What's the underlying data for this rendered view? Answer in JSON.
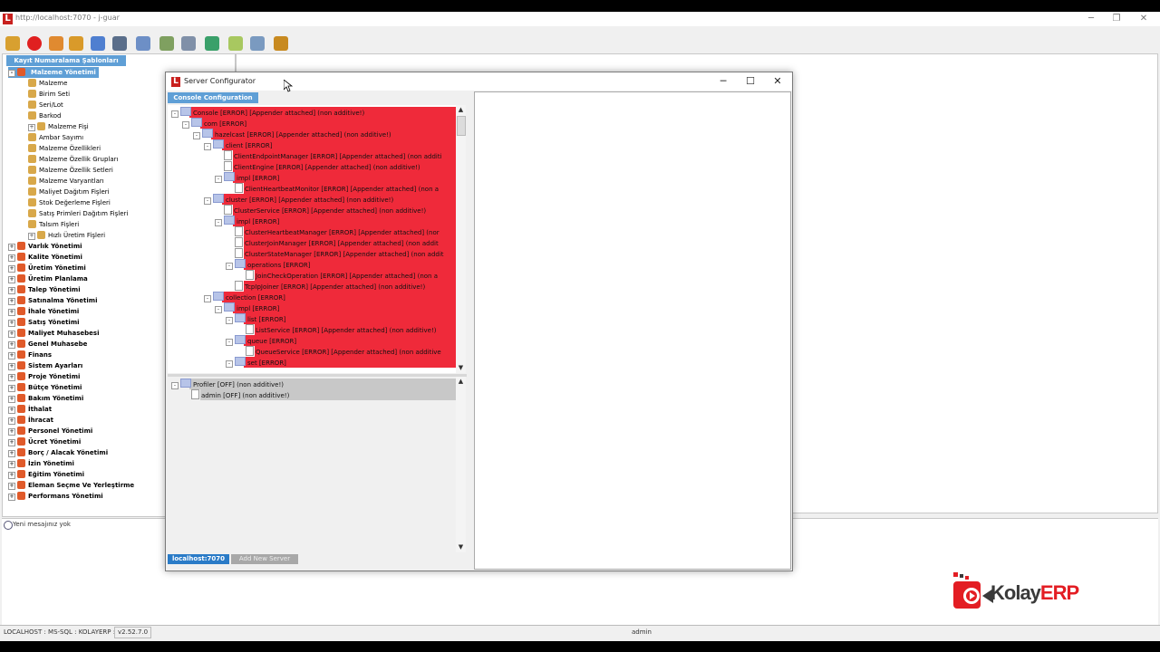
{
  "app": {
    "title": "http://localhost:7070 - j-guar",
    "logo_letter": "L"
  },
  "toolbar": {
    "icons": [
      "key-icon",
      "power-icon",
      "users-icon",
      "user-icon",
      "chart-icon",
      "window-icon",
      "network-icon",
      "tree-icon",
      "card-icon",
      "books-icon",
      "folder-icon",
      "table-icon",
      "wrench-icon"
    ]
  },
  "left": {
    "tab_label": "Kayıt Numaralama Şablonları",
    "root": "Malzeme Yönetimi",
    "children": [
      "Malzeme",
      "Birim Seti",
      "Seri/Lot",
      "Barkod",
      "Malzeme Fişi",
      "Ambar Sayımı",
      "Malzeme Özellikleri",
      "Malzeme Özellik Grupları",
      "Malzeme Özellik Setleri",
      "Malzeme Varyantları",
      "Maliyet Dağıtım Fişleri",
      "Stok Değerleme Fişleri",
      "Satış Primleri Dağıtım Fişleri",
      "Talsım Fişleri",
      "Hızlı Üretim Fişleri"
    ],
    "modules": [
      "Varlık Yönetimi",
      "Kalite Yönetimi",
      "Üretim Yönetimi",
      "Üretim Planlama",
      "Talep Yönetimi",
      "Satınalma Yönetimi",
      "İhale Yönetimi",
      "Satış Yönetimi",
      "Maliyet Muhasebesi",
      "Genel Muhasebe",
      "Finans",
      "Sistem Ayarları",
      "Proje Yönetimi",
      "Bütçe Yönetimi",
      "Bakım Yönetimi",
      "İthalat",
      "İhracat",
      "Personel Yönetimi",
      "Ücret Yönetimi",
      "Borç / Alacak Yönetimi",
      "İzin Yönetimi",
      "Eğitim Yönetimi",
      "Eleman Seçme Ve Yerleştirme",
      "Performans Yönetimi"
    ]
  },
  "messages": {
    "text": "Yeni mesajınız yok"
  },
  "status": {
    "connection": "LOCALHOST : MS-SQL : KOLAYERP :",
    "version": "v2.52.7.0",
    "user": "admin"
  },
  "brand": {
    "name_kolay": "Kolay",
    "name_erp": "ERP",
    "color_red": "#e31d23",
    "color_dark": "#3a3a3a"
  },
  "dialog": {
    "title": "Server Configurator",
    "tab_label": "Console Configuration",
    "loggers": [
      {
        "depth": 0,
        "kind": "folder",
        "pm": "-",
        "text": "Console [ERROR] [Appender attached] (non additive!)"
      },
      {
        "depth": 1,
        "kind": "folder",
        "pm": "-",
        "text": "com [ERROR]"
      },
      {
        "depth": 2,
        "kind": "folder",
        "pm": "-",
        "text": "hazelcast [ERROR] [Appender attached] (non additive!)"
      },
      {
        "depth": 3,
        "kind": "folder",
        "pm": "-",
        "text": "client [ERROR]"
      },
      {
        "depth": 4,
        "kind": "doc",
        "pm": "",
        "text": "ClientEndpointManager [ERROR] [Appender attached] (non additi"
      },
      {
        "depth": 4,
        "kind": "doc",
        "pm": "",
        "text": "ClientEngine [ERROR] [Appender attached] (non additive!)"
      },
      {
        "depth": 4,
        "kind": "folder",
        "pm": "-",
        "text": "impl [ERROR]"
      },
      {
        "depth": 5,
        "kind": "doc",
        "pm": "",
        "text": "ClientHeartbeatMonitor [ERROR] [Appender attached] (non a"
      },
      {
        "depth": 3,
        "kind": "folder",
        "pm": "-",
        "text": "cluster [ERROR] [Appender attached] (non additive!)"
      },
      {
        "depth": 4,
        "kind": "doc",
        "pm": "",
        "text": "ClusterService [ERROR] [Appender attached] (non additive!)"
      },
      {
        "depth": 4,
        "kind": "folder",
        "pm": "-",
        "text": "impl [ERROR]"
      },
      {
        "depth": 5,
        "kind": "doc",
        "pm": "",
        "text": "ClusterHeartbeatManager [ERROR] [Appender attached] (nor"
      },
      {
        "depth": 5,
        "kind": "doc",
        "pm": "",
        "text": "ClusterJoinManager [ERROR] [Appender attached] (non addit"
      },
      {
        "depth": 5,
        "kind": "doc",
        "pm": "",
        "text": "ClusterStateManager [ERROR] [Appender attached] (non addit"
      },
      {
        "depth": 5,
        "kind": "folder",
        "pm": "-",
        "text": "operations [ERROR]"
      },
      {
        "depth": 6,
        "kind": "doc",
        "pm": "",
        "text": "JoinCheckOperation [ERROR] [Appender attached] (non a"
      },
      {
        "depth": 5,
        "kind": "doc",
        "pm": "",
        "text": "TcpIpJoiner [ERROR] [Appender attached] (non additive!)"
      },
      {
        "depth": 3,
        "kind": "folder",
        "pm": "-",
        "text": "collection [ERROR]"
      },
      {
        "depth": 4,
        "kind": "folder",
        "pm": "-",
        "text": "impl [ERROR]"
      },
      {
        "depth": 5,
        "kind": "folder",
        "pm": "-",
        "text": "list [ERROR]"
      },
      {
        "depth": 6,
        "kind": "doc",
        "pm": "",
        "text": "ListService [ERROR] [Appender attached] (non additive!)"
      },
      {
        "depth": 5,
        "kind": "folder",
        "pm": "-",
        "text": "queue [ERROR]"
      },
      {
        "depth": 6,
        "kind": "doc",
        "pm": "",
        "text": "QueueService [ERROR] [Appender attached] (non additive"
      },
      {
        "depth": 5,
        "kind": "folder",
        "pm": "-",
        "text": "set [ERROR]"
      }
    ],
    "profiler": [
      {
        "depth": 0,
        "kind": "folder",
        "pm": "-",
        "text": "Profiler [OFF] (non additive!)"
      },
      {
        "depth": 1,
        "kind": "doc",
        "pm": "",
        "text": "admin [OFF] (non additive!)"
      }
    ],
    "server_tab": "localhost:7070",
    "add_server": "Add New Server"
  }
}
